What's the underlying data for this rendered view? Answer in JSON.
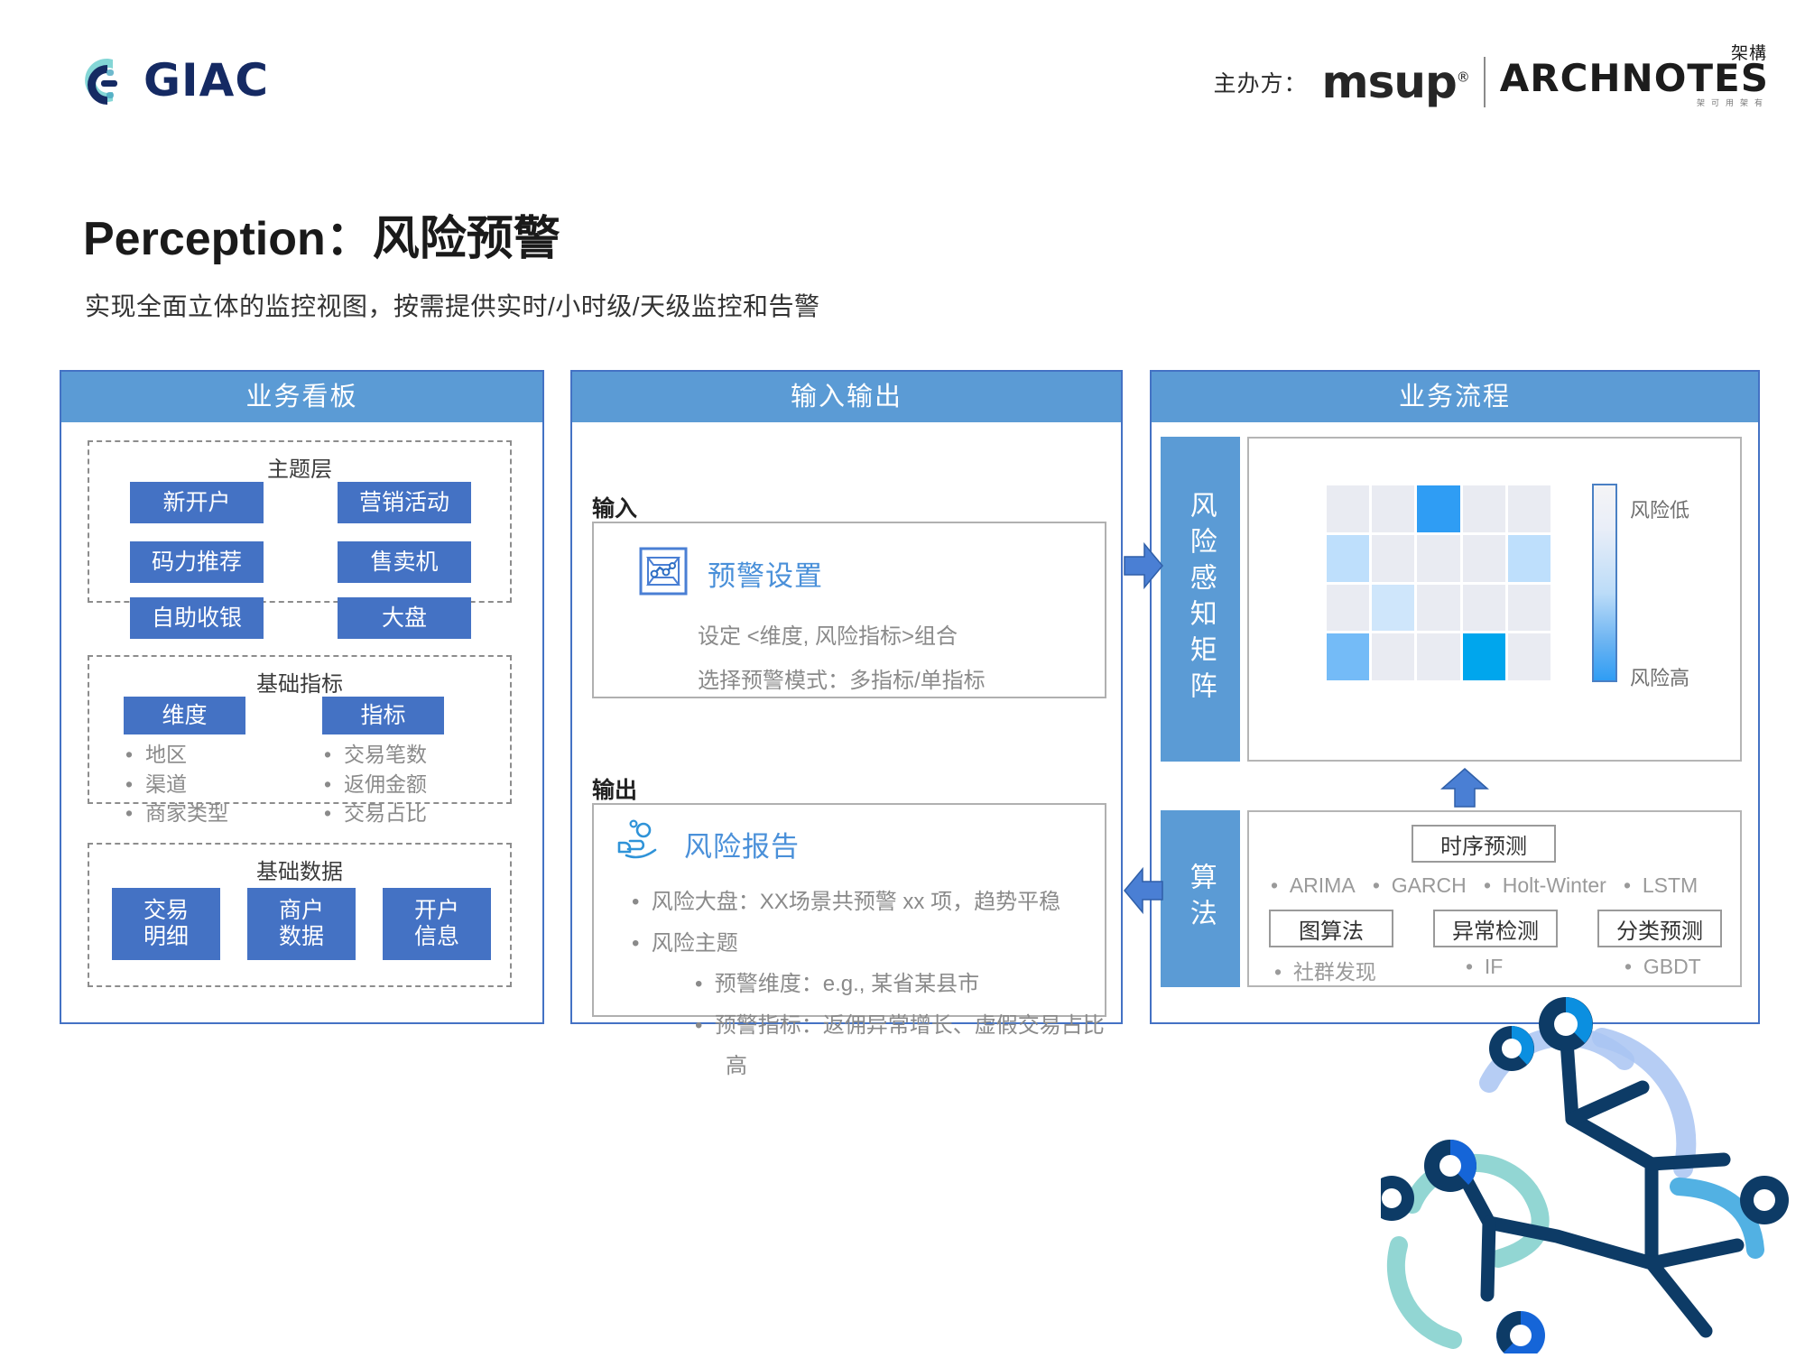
{
  "header": {
    "brand": "GIAC",
    "host_label": "主办方：",
    "msup": "msup",
    "msup_reg": "®",
    "arch_cn": "架構",
    "arch_logo": "ARCHNOTES",
    "arch_sub": "架可用架有"
  },
  "title": "Perception：风险预警",
  "subtitle": "实现全面立体的监控视图，按需提供实时/小时级/天级监控和告警",
  "colors": {
    "header_blue": "#5B9BD5",
    "box_blue": "#4472C4",
    "accent_cyan": "#2f9df4",
    "border_gray": "#b0b0b0",
    "text_gray": "#8a8a8a"
  },
  "panels": {
    "dashboard": {
      "title": "业务看板",
      "groups": [
        {
          "name": "主题层",
          "boxes": [
            "新开户",
            "营销活动",
            "码力推荐",
            "售卖机",
            "自助收银",
            "大盘"
          ]
        },
        {
          "name": "基础指标",
          "boxes": [
            "维度",
            "指标"
          ],
          "left_bullets": [
            "地区",
            "渠道",
            "商家类型"
          ],
          "right_bullets": [
            "交易笔数",
            "返佣金额",
            "交易占比"
          ]
        },
        {
          "name": "基础数据",
          "boxes": [
            "交易\n明细",
            "商户\n数据",
            "开户\n信息"
          ],
          "box_lines": [
            [
              "交易",
              "明细"
            ],
            [
              "商户",
              "数据"
            ],
            [
              "开户",
              "信息"
            ]
          ]
        }
      ]
    },
    "io": {
      "title": "输入输出",
      "input_label": "输入",
      "output_label": "输出",
      "input_card": {
        "icon": "chart-cube-icon",
        "title": "预警设置",
        "lines": [
          "设定 <维度, 风险指标>组合",
          "选择预警模式：多指标/单指标"
        ]
      },
      "output_card": {
        "icon": "hand-person-icon",
        "title": "风险报告",
        "bullets": [
          {
            "level": 1,
            "text": "风险大盘：XX场景共预警 xx 项，趋势平稳"
          },
          {
            "level": 1,
            "text": "风险主题"
          },
          {
            "level": 2,
            "text": "预警维度：e.g., 某省某县市"
          },
          {
            "level": 2,
            "text": "预警指标：返佣异常增长、虚假交易占比高"
          }
        ]
      }
    },
    "flow": {
      "title": "业务流程",
      "matrix_tab": "风险感知矩阵",
      "algo_tab": "算法",
      "colorbar": {
        "top_label": "风险低",
        "bottom_label": "风险高"
      },
      "algorithms": {
        "top_box": "时序预测",
        "top_items": [
          "ARIMA",
          "GARCH",
          "Holt-Winter",
          "LSTM"
        ],
        "boxes": [
          "图算法",
          "异常检测",
          "分类预测"
        ],
        "box_items": [
          "社群发现",
          "IF",
          "GBDT"
        ]
      }
    }
  },
  "arrows": {
    "io_to_flow": "arrow-right",
    "flow_to_io": "arrow-left",
    "algo_to_matrix": "arrow-up"
  },
  "chart_data": {
    "type": "heatmap",
    "title": "风险感知矩阵",
    "rows": 4,
    "cols": 5,
    "legend_position": "right",
    "legend_labels": [
      "风险低",
      "风险高"
    ],
    "colorscale": [
      "#e9ebf2",
      "#cfe6fb",
      "#bedffc",
      "#6cb4f2",
      "#2f9df4",
      "#00a6ed"
    ],
    "values": [
      [
        0.05,
        0.05,
        0.85,
        0.05,
        0.05
      ],
      [
        0.4,
        0.05,
        0.05,
        0.05,
        0.4
      ],
      [
        0.05,
        0.38,
        0.05,
        0.05,
        0.05
      ],
      [
        0.62,
        0.05,
        0.05,
        0.95,
        0.05
      ]
    ],
    "cell_colors": [
      [
        "#e9ebf2",
        "#e9ebf2",
        "#2f9df4",
        "#e9ebf2",
        "#e9ebf2"
      ],
      [
        "#bedffc",
        "#e9ebf2",
        "#e9ebf2",
        "#e9ebf2",
        "#bedffc"
      ],
      [
        "#e9ebf2",
        "#cfe6fb",
        "#e9ebf2",
        "#e9ebf2",
        "#e9ebf2"
      ],
      [
        "#74bbf7",
        "#e9ebf2",
        "#e9ebf2",
        "#00a6ed",
        "#e9ebf2"
      ]
    ]
  }
}
